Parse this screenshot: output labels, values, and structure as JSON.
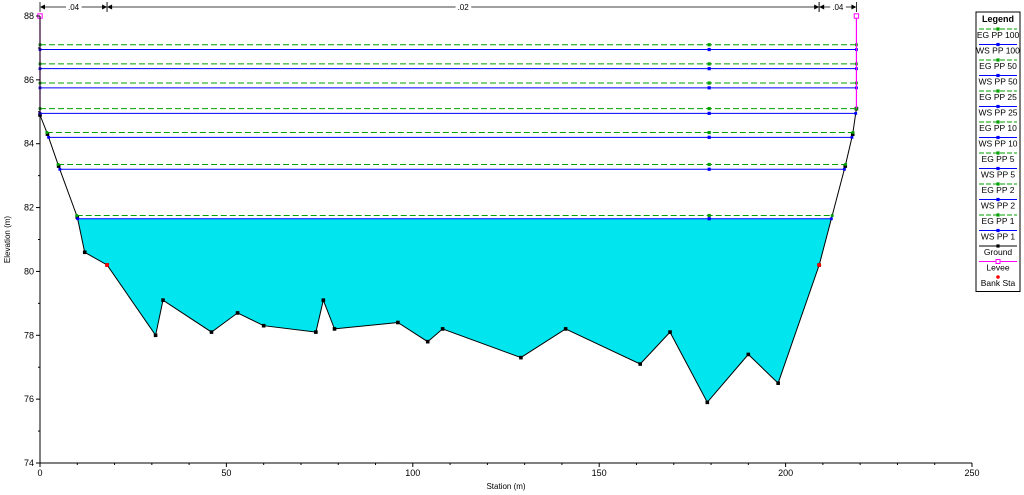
{
  "chart_data": {
    "type": "line",
    "xlabel": "Station (m)",
    "ylabel": "Elevation (m)",
    "xlim": [
      0,
      250
    ],
    "ylim": [
      74,
      88
    ],
    "x_ticks": [
      "0",
      "50",
      "100",
      "150",
      "200",
      "250"
    ],
    "y_ticks": [
      "74",
      "76",
      "78",
      "80",
      "82",
      "84",
      "86",
      "88"
    ],
    "grid": false,
    "legend_position": "right",
    "legend_title": "Legend",
    "colors": {
      "water": "#00e5ee",
      "ground": "#000000",
      "eg": "#00a000",
      "ws": "#0000ff",
      "levee": "#ff00ff",
      "bank": "#ff0000"
    },
    "manning": [
      {
        "label": ".04",
        "x_start": 0,
        "x_end": 18
      },
      {
        "label": ".02",
        "x_start": 18,
        "x_end": 209
      },
      {
        "label": ".04",
        "x_start": 209,
        "x_end": 219
      }
    ],
    "ground": {
      "name": "Ground",
      "x": [
        0,
        2,
        5,
        10,
        12,
        18,
        31,
        33,
        46,
        53,
        60,
        74,
        76,
        79,
        96,
        104,
        108,
        129,
        141,
        161,
        169,
        179,
        190,
        198,
        209,
        216,
        218,
        219
      ],
      "y": [
        84.9,
        84.3,
        83.3,
        81.7,
        80.6,
        80.2,
        78.0,
        79.1,
        78.1,
        78.7,
        78.3,
        78.1,
        79.1,
        78.2,
        78.4,
        77.8,
        78.2,
        77.3,
        78.2,
        77.1,
        78.1,
        75.9,
        77.4,
        76.5,
        80.2,
        83.3,
        84.3,
        85.1
      ]
    },
    "levee": {
      "name": "Levee",
      "points": [
        {
          "x": 0,
          "y_top": 88.0,
          "y_bottom": 84.9
        },
        {
          "x": 219,
          "y_top": 88.0,
          "y_bottom": 85.1
        }
      ]
    },
    "bank_stations": {
      "name": "Bank Sta",
      "points": [
        {
          "x": 18,
          "y": 80.2
        },
        {
          "x": 209,
          "y": 80.2
        }
      ]
    },
    "profiles": [
      {
        "name": "PP 100",
        "eg": 87.1,
        "ws": 86.95,
        "eg_x": 179.5,
        "ws_x": 179.5
      },
      {
        "name": "PP 50",
        "eg": 86.5,
        "ws": 86.35,
        "eg_x": 179.5,
        "ws_x": 179.5
      },
      {
        "name": "PP 25",
        "eg": 85.9,
        "ws": 85.75,
        "eg_x": 179.5,
        "ws_x": 179.5
      },
      {
        "name": "PP 10",
        "eg": 85.1,
        "ws": 84.95,
        "eg_x": 179.5,
        "ws_x": 179.5
      },
      {
        "name": "PP 5",
        "eg": 84.35,
        "ws": 84.2,
        "eg_x": 179.5,
        "ws_x": 179.5
      },
      {
        "name": "PP 2",
        "eg": 83.35,
        "ws": 83.2,
        "eg_x": 179.5,
        "ws_x": 179.5
      },
      {
        "name": "PP 1",
        "eg": 81.75,
        "ws": 81.65,
        "eg_x": 179.5,
        "ws_x": 179.5
      }
    ],
    "legend": [
      "EG PP 100",
      "WS PP 100",
      "EG PP 50",
      "WS PP 50",
      "EG PP 25",
      "WS PP 25",
      "EG PP 10",
      "WS PP 10",
      "EG PP 5",
      "WS PP 5",
      "EG PP 2",
      "WS PP 2",
      "EG PP 1",
      "WS PP 1",
      "Ground",
      "Levee",
      "Bank Sta"
    ]
  }
}
